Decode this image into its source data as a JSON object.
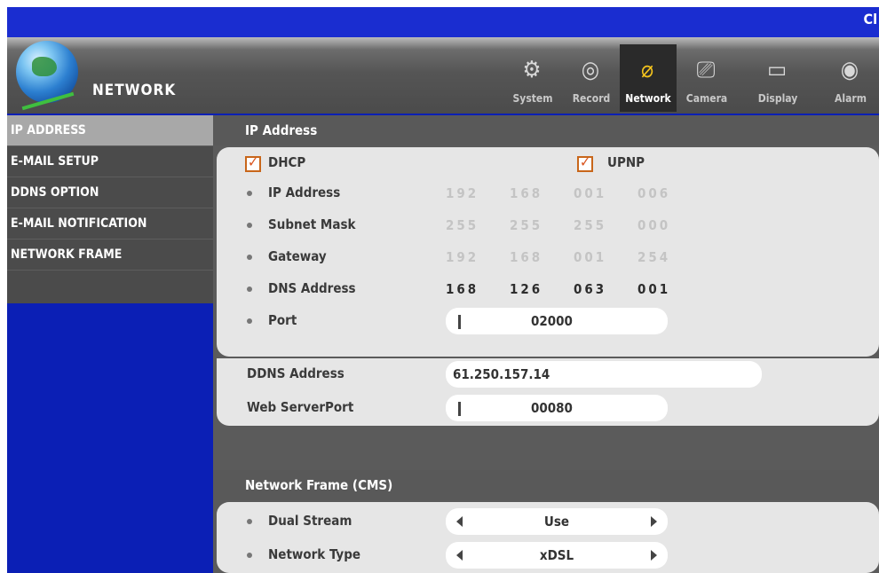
{
  "window": {
    "title_fragment": "Cl"
  },
  "header": {
    "section_title": "NETWORK"
  },
  "menu": [
    {
      "label": "System",
      "icon": "system-icon"
    },
    {
      "label": "Record",
      "icon": "record-icon"
    },
    {
      "label": "Network",
      "icon": "network-icon",
      "active": true
    },
    {
      "label": "Camera",
      "icon": "camera-icon"
    },
    {
      "label": "Display",
      "icon": "display-icon"
    },
    {
      "label": "Alarm",
      "icon": "alarm-icon"
    }
  ],
  "sidebar": {
    "items": [
      {
        "label": "IP ADDRESS",
        "selected": true
      },
      {
        "label": "E-MAIL SETUP"
      },
      {
        "label": "DDNS OPTION"
      },
      {
        "label": "E-MAIL NOTIFICATION"
      },
      {
        "label": "NETWORK FRAME"
      }
    ]
  },
  "ip_section": {
    "title": "IP Address",
    "dhcp_label": "DHCP",
    "dhcp_checked": true,
    "upnp_label": "UPNP",
    "upnp_checked": true,
    "ip_address": {
      "label": "IP Address",
      "octets": [
        "192",
        "168",
        "001",
        "006"
      ]
    },
    "subnet_mask": {
      "label": "Subnet Mask",
      "octets": [
        "255",
        "255",
        "255",
        "000"
      ]
    },
    "gateway": {
      "label": "Gateway",
      "octets": [
        "192",
        "168",
        "001",
        "254"
      ]
    },
    "dns_address": {
      "label": "DNS Address",
      "octets": [
        "168",
        "126",
        "063",
        "001"
      ]
    },
    "port": {
      "label": "Port",
      "value": "02000"
    }
  },
  "ddns": {
    "address_label": "DDNS Address",
    "address_value": "61.250.157.14",
    "web_port_label": "Web ServerPort",
    "web_port_value": "00080"
  },
  "network_frame": {
    "title": "Network Frame (CMS)",
    "dual_stream": {
      "label": "Dual Stream",
      "value": "Use"
    },
    "network_type": {
      "label": "Network Type",
      "value": "xDSL"
    }
  },
  "colors": {
    "background": "#0b1fb5",
    "panel": "#5b5b5b",
    "card": "#e6e6e6",
    "accent": "#f2c21d",
    "checkbox": "#d9531e"
  }
}
